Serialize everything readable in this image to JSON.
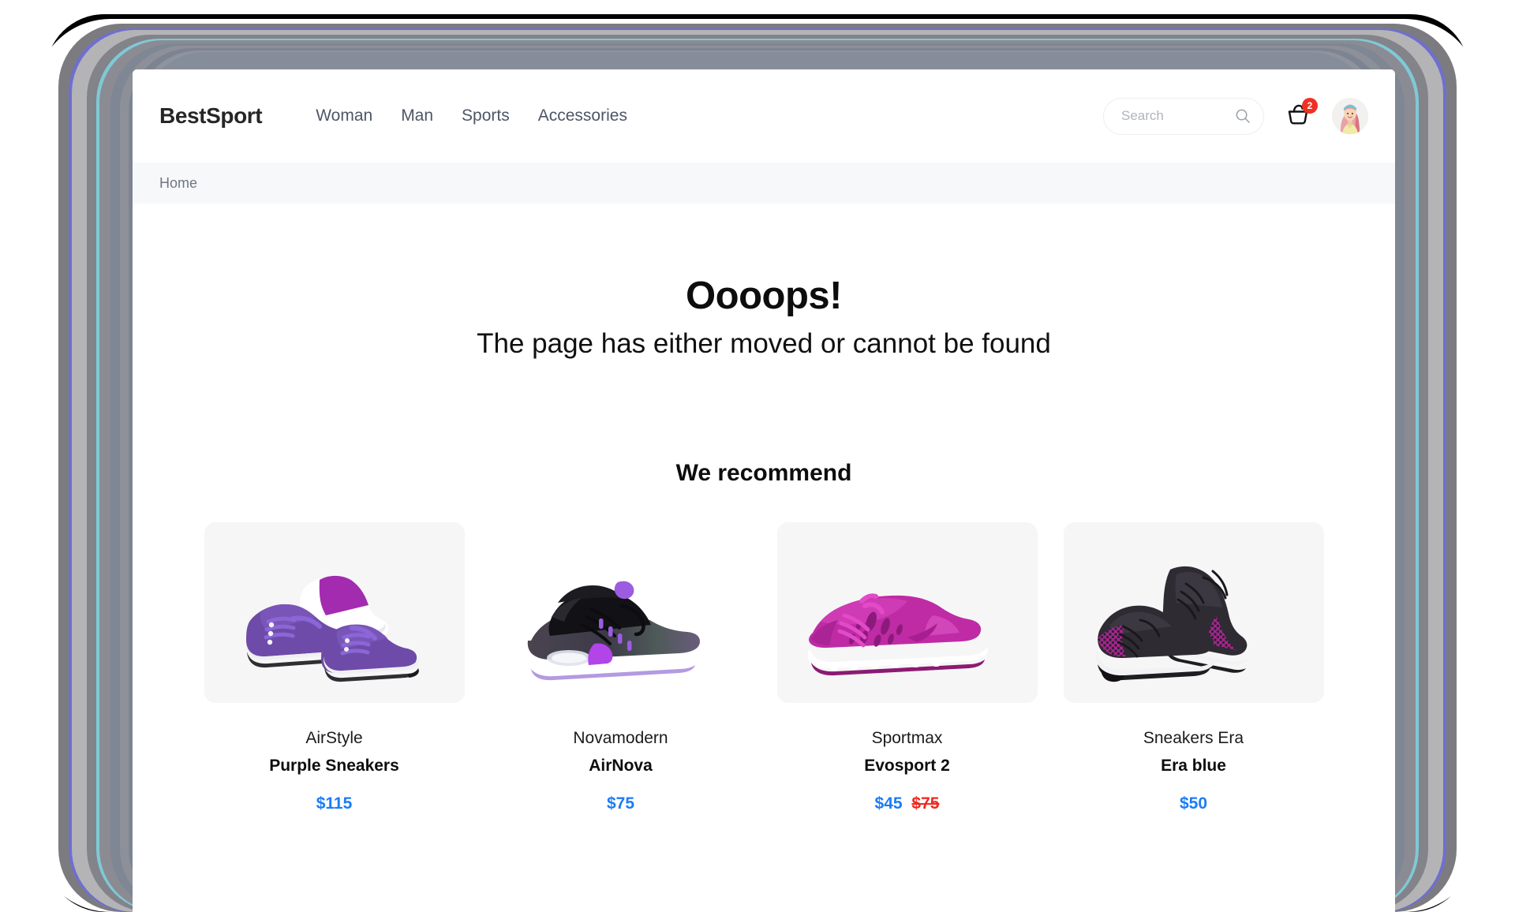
{
  "header": {
    "brand": "BestSport",
    "nav": [
      {
        "label": "Woman"
      },
      {
        "label": "Man"
      },
      {
        "label": "Sports"
      },
      {
        "label": "Accessories"
      }
    ],
    "search": {
      "placeholder": "Search",
      "value": "",
      "icon": "search-icon"
    },
    "cart": {
      "icon": "shopping-basket-icon",
      "badge_count": "2",
      "badge_color": "#ef3124"
    },
    "avatar": {
      "icon": "user-avatar",
      "alt": "User profile photo"
    }
  },
  "breadcrumb": {
    "items": [
      {
        "label": "Home"
      }
    ]
  },
  "error": {
    "title": "Oooops!",
    "subtitle": "The page has either moved or cannot be found"
  },
  "recommend": {
    "heading": "We recommend",
    "products": [
      {
        "brand": "AirStyle",
        "name": "Purple Sneakers",
        "price": "$115",
        "old_price": "",
        "image_alt": "Pair of purple suede sneakers",
        "card_bg": "#f6f6f7"
      },
      {
        "brand": "Novamodern",
        "name": "AirNova",
        "price": "$75",
        "old_price": "",
        "image_alt": "Black running sneaker with purple accents and air sole",
        "card_bg": "#ffffff"
      },
      {
        "brand": "Sportmax",
        "name": "Evosport 2",
        "price": "$45",
        "old_price": "$75",
        "image_alt": "Magenta perforated running shoe",
        "card_bg": "#f6f6f7"
      },
      {
        "brand": "Sneakers Era",
        "name": "Era blue",
        "price": "$50",
        "old_price": "",
        "image_alt": "Pair of black and magenta mesh sneakers",
        "card_bg": "#f6f6f7"
      }
    ]
  },
  "theme": {
    "accent_price": "#1b7cf5",
    "sale_price": "#ef2a20",
    "badge": "#ef3124",
    "nav_text": "#4e5665",
    "breadcrumb_bg": "#f7f8f9"
  }
}
